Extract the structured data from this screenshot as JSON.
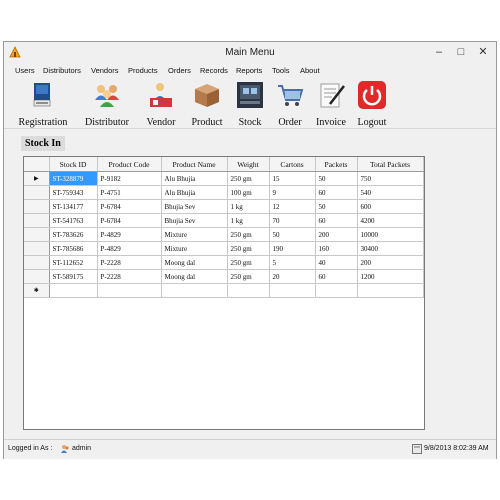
{
  "window": {
    "title": "Main Menu",
    "minimize": "–",
    "maximize": "□",
    "close": "✕"
  },
  "menu": [
    "Users",
    "Distributors",
    "Vendors",
    "Products",
    "Orders",
    "Records",
    "Reports",
    "Tools",
    "About"
  ],
  "toolbar": [
    {
      "label": "Registration",
      "icon": "registration-book-icon"
    },
    {
      "label": "Distributor",
      "icon": "people-group-icon"
    },
    {
      "label": "Vendor",
      "icon": "vendor-person-icon"
    },
    {
      "label": "Product",
      "icon": "box-icon"
    },
    {
      "label": "Stock",
      "icon": "stock-icon"
    },
    {
      "label": "Order",
      "icon": "cart-icon"
    },
    {
      "label": "Invoice",
      "icon": "invoice-pen-icon"
    },
    {
      "label": "Logout",
      "icon": "power-icon"
    }
  ],
  "section_title": "Stock In",
  "grid": {
    "columns": [
      "Stock ID",
      "Product Code",
      "Product Name",
      "Weight",
      "Cartons",
      "Packets",
      "Total Packets"
    ],
    "rows": [
      [
        "ST-328879",
        "P-9182",
        "Alu Bhujia",
        "250 gm",
        "15",
        "50",
        "750"
      ],
      [
        "ST-759343",
        "P-4751",
        "Alu Bhujia",
        "100 gm",
        "9",
        "60",
        "540"
      ],
      [
        "ST-134177",
        "P-6784",
        "Bhujia Sev",
        "1 kg",
        "12",
        "50",
        "600"
      ],
      [
        "ST-541763",
        "P-6784",
        "Bhujia Sev",
        "1 kg",
        "70",
        "60",
        "4200"
      ],
      [
        "ST-783626",
        "P-4829",
        "Mixture",
        "250 gm",
        "50",
        "200",
        "10000"
      ],
      [
        "ST-785686",
        "P-4829",
        "Mixture",
        "250 gm",
        "190",
        "160",
        "30400"
      ],
      [
        "ST-112652",
        "P-2228",
        "Moong dal",
        "250 gm",
        "5",
        "40",
        "200"
      ],
      [
        "ST-589175",
        "P-2228",
        "Moong dal",
        "250 gm",
        "20",
        "60",
        "1200"
      ]
    ],
    "current_row_marker": "▶",
    "new_row_marker": "✱"
  },
  "status": {
    "logged_in_label": "Logged in As :",
    "user": "admin",
    "datetime": "9/8/2013 8:02:39 AM"
  }
}
